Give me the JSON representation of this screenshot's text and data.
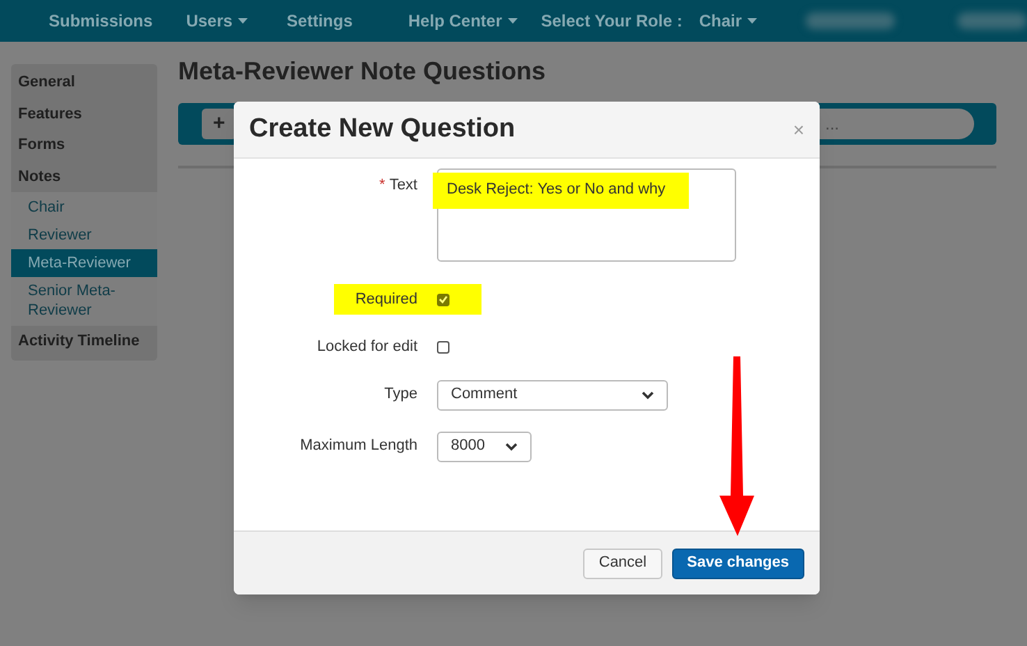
{
  "navbar": {
    "items": [
      {
        "label": "Submissions",
        "dropdown": false
      },
      {
        "label": "Users",
        "dropdown": true
      },
      {
        "label": "Settings",
        "dropdown": false
      },
      {
        "label": "Help Center",
        "dropdown": true
      }
    ],
    "role_label": "Select Your Role :",
    "role": {
      "label": "Chair",
      "dropdown": true
    }
  },
  "sidebar": {
    "items": [
      {
        "label": "General",
        "selected": false
      },
      {
        "label": "Features",
        "selected": false
      },
      {
        "label": "Forms",
        "selected": false
      },
      {
        "label": "Notes",
        "selected": false,
        "children": [
          {
            "label": "Chair",
            "selected": false
          },
          {
            "label": "Reviewer",
            "selected": false
          },
          {
            "label": "Meta-Reviewer",
            "selected": true
          },
          {
            "label": "Senior Meta-Reviewer",
            "selected": false
          }
        ]
      },
      {
        "label": "Activity Timeline",
        "selected": false
      }
    ]
  },
  "page_title": "Meta-Reviewer Note Questions",
  "toolbar": {
    "add_button": "+",
    "search": {
      "placeholder": "..."
    }
  },
  "modal": {
    "title": "Create New Question",
    "close": "×",
    "fields": [
      {
        "kind": "textarea",
        "label": "Text",
        "required_mark": "*",
        "value": "Desk Reject: Yes or No and why",
        "highlighted": true
      },
      {
        "kind": "checkbox",
        "label": "Required",
        "checked": true,
        "highlighted": true
      },
      {
        "kind": "checkbox",
        "label": "Locked for edit",
        "checked": false
      },
      {
        "kind": "select",
        "label": "Type",
        "value": "Comment"
      },
      {
        "kind": "select",
        "label": "Maximum Length",
        "value": "8000"
      }
    ],
    "buttons": [
      {
        "label": "Cancel",
        "primary": false
      },
      {
        "label": "Save changes",
        "primary": true
      }
    ]
  }
}
